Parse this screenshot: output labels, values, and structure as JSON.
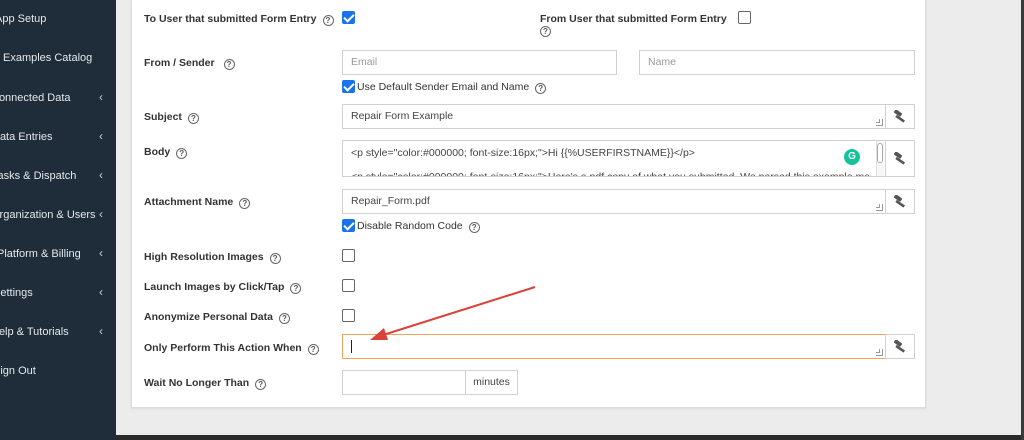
{
  "sidebar": {
    "items": [
      {
        "label": "App Setup",
        "chevron": false
      },
      {
        "label": "Examples Catalog",
        "chevron": false
      },
      {
        "label": "Connected Data",
        "chevron": true
      },
      {
        "label": "Data Entries",
        "chevron": true
      },
      {
        "label": "Tasks & Dispatch",
        "chevron": true
      },
      {
        "label": "Organization & Users",
        "chevron": true
      },
      {
        "label": "Platform & Billing",
        "chevron": true
      },
      {
        "label": "Settings",
        "chevron": true
      },
      {
        "label": "Help & Tutorials",
        "chevron": true
      },
      {
        "label": "Sign Out",
        "chevron": false
      }
    ],
    "chevron_glyph": "‹"
  },
  "form": {
    "to_user": {
      "label": "To User that submitted Form Entry",
      "checked": true
    },
    "from_user": {
      "label": "From User that submitted Form Entry",
      "checked": false
    },
    "sender": {
      "label": "From / Sender",
      "email_placeholder": "Email",
      "name_placeholder": "Name",
      "default_sender_label": "Use Default Sender Email and Name",
      "default_sender_checked": true
    },
    "subject": {
      "label": "Subject",
      "value": "Repair Form Example"
    },
    "body": {
      "label": "Body",
      "line1": "<p style=\"color:#000000; font-size:16px;\">Hi {{%USERFIRSTNAME}}</p>",
      "line2": "<p style=\"color:#000000; font-size:16px;\">Here's a pdf copy of what you submitted. We parsed this example mail"
    },
    "attachment": {
      "label": "Attachment Name",
      "value": "Repair_Form.pdf",
      "random_code_label": "Disable Random Code",
      "random_code_checked": true
    },
    "high_res": {
      "label": "High Resolution Images",
      "checked": false
    },
    "launch_images": {
      "label": "Launch Images by Click/Tap",
      "checked": false
    },
    "anonymize": {
      "label": "Anonymize Personal Data",
      "checked": false
    },
    "condition": {
      "label": "Only Perform This Action When",
      "value": ""
    },
    "wait": {
      "label": "Wait No Longer Than",
      "value": "",
      "unit": "minutes"
    }
  },
  "icons": {
    "help": "?",
    "grammarly": "G",
    "tool": "hammer-icon"
  },
  "colors": {
    "sidebar_bg": "#1f2d3a",
    "checkbox_on": "#1a73e8",
    "focus_border": "#f0a35e",
    "arrow": "#d9433a",
    "grammarly": "#15c39a"
  }
}
